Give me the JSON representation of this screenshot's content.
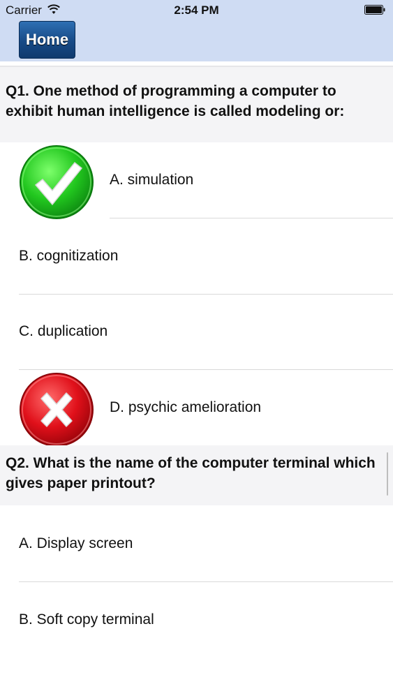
{
  "status_bar": {
    "carrier": "Carrier",
    "time": "2:54 PM"
  },
  "nav": {
    "home_label": "Home"
  },
  "questions": [
    {
      "text": "Q1. One method of programming a computer to exhibit human intelligence is called modeling or:",
      "options": [
        {
          "label": "A. simulation",
          "mark": "correct"
        },
        {
          "label": "B. cognitization",
          "mark": ""
        },
        {
          "label": "C. duplication",
          "mark": ""
        },
        {
          "label": "D. psychic amelioration",
          "mark": "wrong"
        }
      ]
    },
    {
      "text": "Q2. What is the name of the computer terminal which gives paper printout?",
      "options": [
        {
          "label": "A. Display screen",
          "mark": ""
        },
        {
          "label": "B. Soft copy terminal",
          "mark": ""
        }
      ]
    }
  ],
  "colors": {
    "nav_background": "#cfdcf3",
    "correct_green": "#2ecc2e",
    "wrong_red": "#e0101a"
  }
}
